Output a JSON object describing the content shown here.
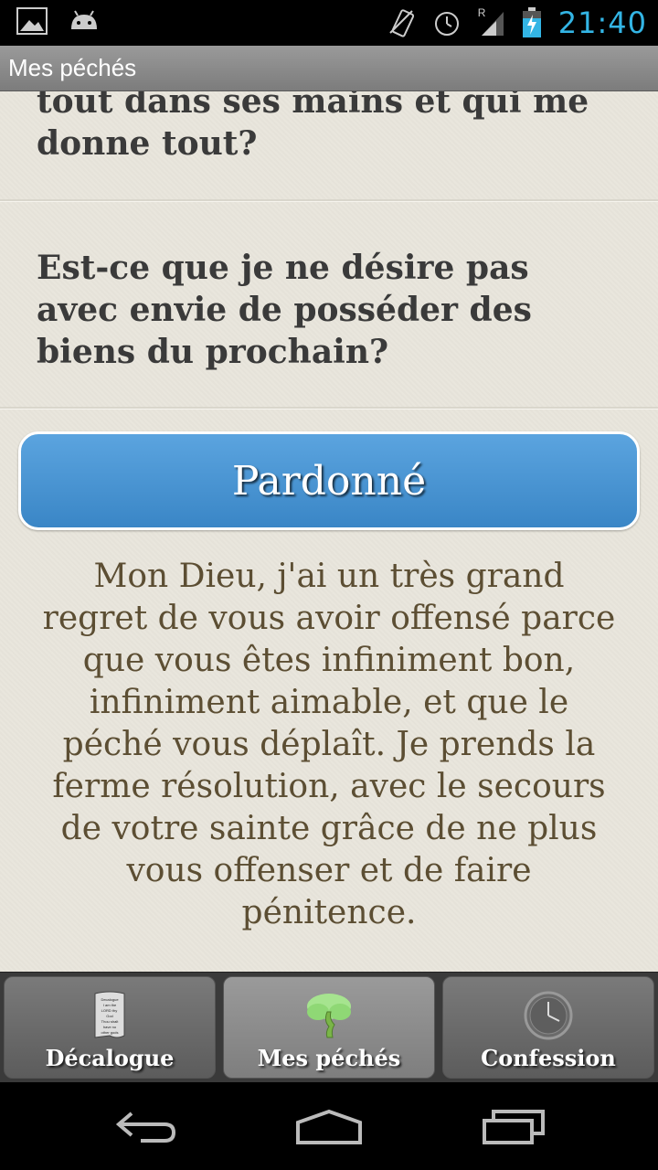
{
  "status_bar": {
    "time": "21:40",
    "icons": [
      "image-icon",
      "android-icon",
      "vibrate-icon",
      "alarm-icon",
      "signal-icon",
      "battery-charging-icon"
    ],
    "signal_label": "R",
    "accent": "#33b5e5"
  },
  "action_bar": {
    "title": "Mes péchés"
  },
  "sins": [
    {
      "text": "tout dans ses mains et qui me donne tout?"
    },
    {
      "text": "Est-ce que je ne désire pas avec envie de posséder des biens du prochain?"
    }
  ],
  "pardon_button": {
    "label": "Pardonné",
    "color": "#4a95d3"
  },
  "prayer": {
    "text": "Mon Dieu, j'ai un très grand regret de vous avoir offensé parce que vous êtes infiniment bon, infiniment aimable, et que le péché vous déplaît. Je prends la ferme résolution, avec le secours de votre sainte grâce de ne plus vous offenser et de faire pénitence."
  },
  "tabs": [
    {
      "label": "Décalogue",
      "icon": "tablet-icon",
      "active": false
    },
    {
      "label": "Mes péchés",
      "icon": "tree-icon",
      "active": true
    },
    {
      "label": "Confession",
      "icon": "clock-icon",
      "active": false
    }
  ],
  "tablet_icon_text": "Decalogue I am the LORD thy God Thou shalt have no other gods",
  "nav_bar": {
    "buttons": [
      "back-icon",
      "home-icon",
      "recent-apps-icon"
    ]
  }
}
